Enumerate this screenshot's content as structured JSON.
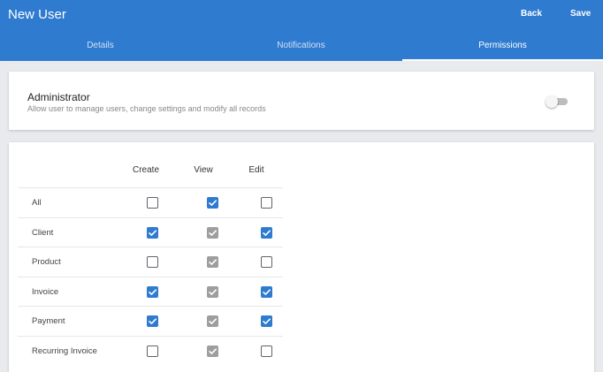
{
  "header": {
    "title": "New User",
    "back_label": "Back",
    "save_label": "Save"
  },
  "tabs": [
    {
      "label": "Details",
      "active": false
    },
    {
      "label": "Notifications",
      "active": false
    },
    {
      "label": "Permissions",
      "active": true
    }
  ],
  "admin": {
    "title": "Administrator",
    "description": "Allow user to manage users, change settings and modify all records",
    "enabled": false
  },
  "permissions": {
    "columns": [
      "Create",
      "View",
      "Edit"
    ],
    "rows": [
      {
        "label": "All",
        "create": "unchecked",
        "view": "checked",
        "edit": "unchecked"
      },
      {
        "label": "Client",
        "create": "checked",
        "view": "checked-disabled",
        "edit": "checked"
      },
      {
        "label": "Product",
        "create": "unchecked",
        "view": "checked-disabled",
        "edit": "unchecked"
      },
      {
        "label": "Invoice",
        "create": "checked",
        "view": "checked-disabled",
        "edit": "checked"
      },
      {
        "label": "Payment",
        "create": "checked",
        "view": "checked-disabled",
        "edit": "checked"
      },
      {
        "label": "Recurring Invoice",
        "create": "unchecked",
        "view": "checked-disabled",
        "edit": "unchecked"
      }
    ]
  },
  "colors": {
    "primary": "#2f7bd0",
    "checked": "#2f7bd0",
    "checked_disabled": "#9e9e9e",
    "background": "#e8eaed"
  }
}
